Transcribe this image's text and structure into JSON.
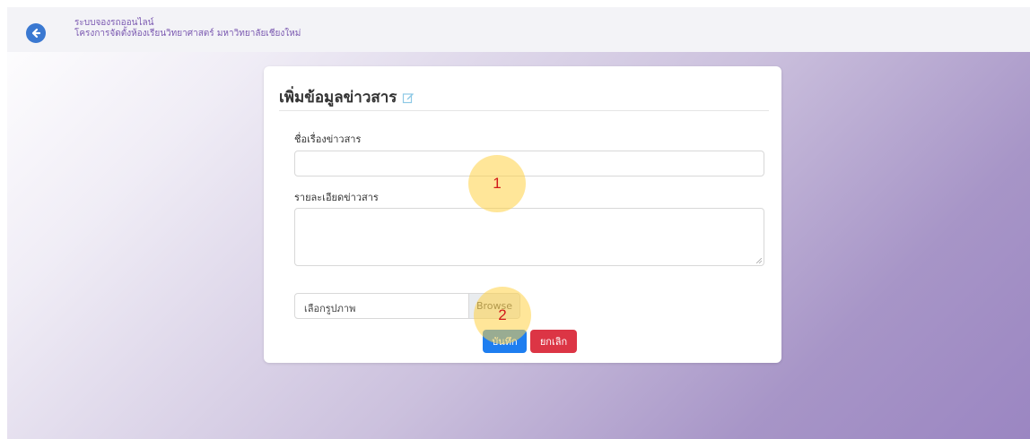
{
  "header": {
    "brand_line1": "ระบบจองรถออนไลน์",
    "brand_line2": "โครงการจัดตั้งห้องเรียนวิทยาศาสตร์ มหาวิทยาลัยเชียงใหม่",
    "back_icon": "arrow-left-circle-icon"
  },
  "form": {
    "title": "เพิ่มข้อมูลข่าวสาร",
    "title_icon": "edit-icon",
    "news_title_label": "ชื่อเรื่องข่าวสาร",
    "news_title_value": "",
    "news_detail_label": "รายละเอียดข่าวสาร",
    "news_detail_value": "",
    "image_label": "เลือกรูปภาพ",
    "browse_label": "Browse",
    "save_label": "บันทึก",
    "cancel_label": "ยกเลิก"
  },
  "annotations": {
    "marker_1": "1",
    "marker_2": "2"
  },
  "colors": {
    "primary": "#1e7ef0",
    "danger": "#dc3545",
    "accent": "#7a58b0",
    "marker": "#ffd246"
  }
}
